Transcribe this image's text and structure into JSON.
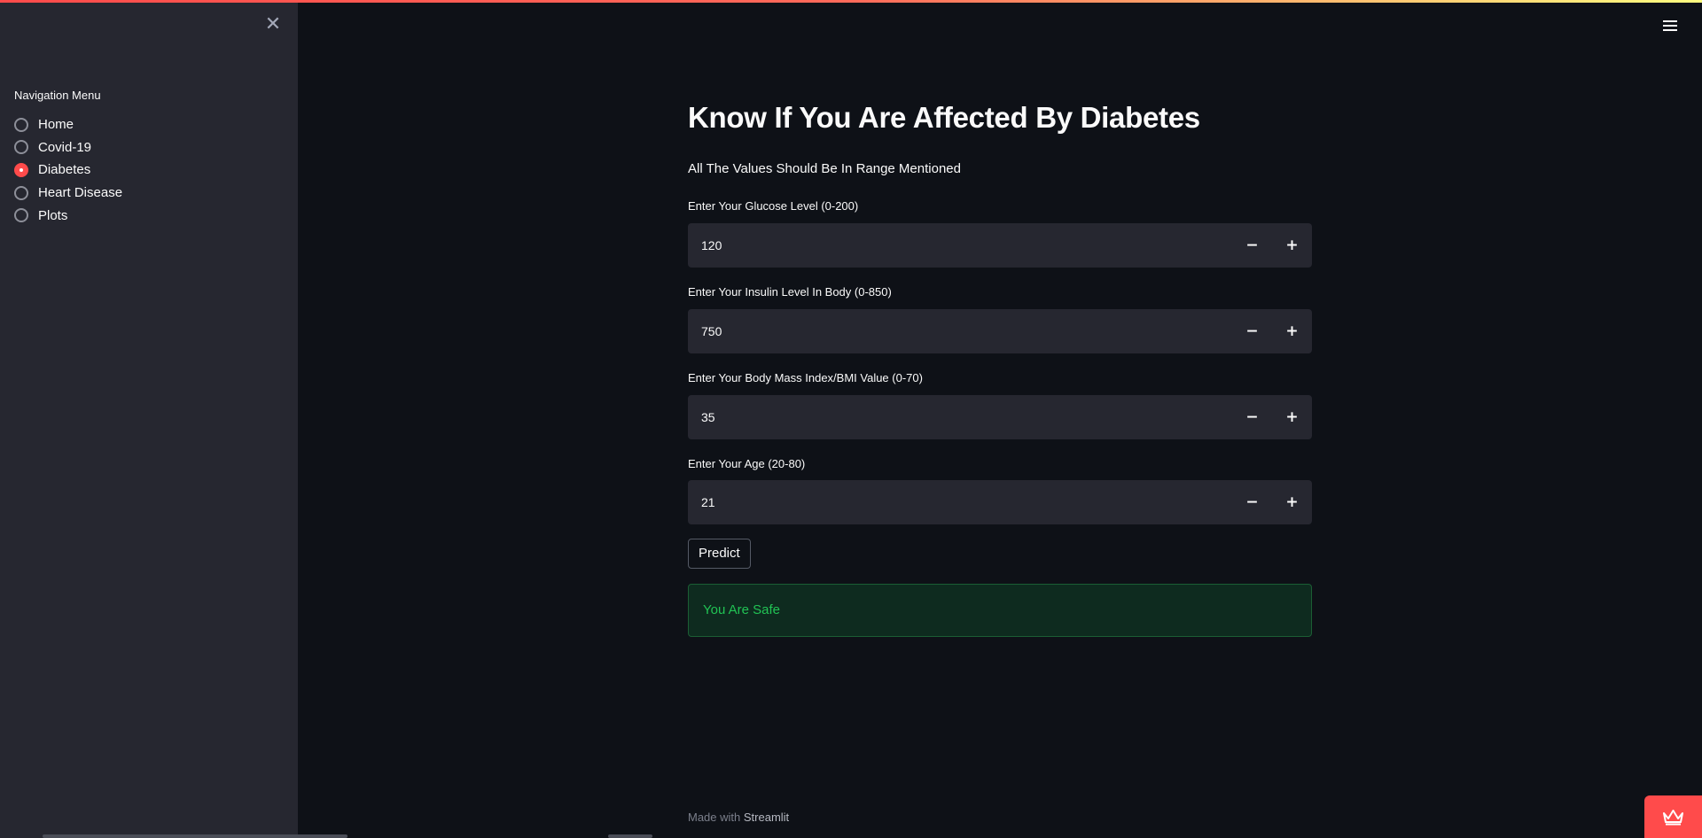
{
  "sidebar": {
    "close_icon": "✕",
    "nav_title": "Navigation Menu",
    "items": [
      {
        "label": "Home",
        "selected": false
      },
      {
        "label": "Covid-19",
        "selected": false
      },
      {
        "label": "Diabetes",
        "selected": true
      },
      {
        "label": "Heart Disease",
        "selected": false
      },
      {
        "label": "Plots",
        "selected": false
      }
    ]
  },
  "header": {
    "menu_icon": "hamburger-menu-icon"
  },
  "main": {
    "title": "Know If You Are Affected By Diabetes",
    "subtitle": "All The Values Should Be In Range Mentioned",
    "fields": [
      {
        "label": "Enter Your Glucose Level (0-200)",
        "value": "120"
      },
      {
        "label": "Enter Your Insulin Level In Body (0-850)",
        "value": "750"
      },
      {
        "label": "Enter Your Body Mass Index/BMI Value (0-70)",
        "value": "35"
      },
      {
        "label": "Enter Your Age (20-80)",
        "value": "21"
      }
    ],
    "stepper": {
      "minus": "−",
      "plus": "+"
    },
    "predict_label": "Predict",
    "result": "You Are Safe"
  },
  "footer": {
    "prefix": "Made with ",
    "brand": "Streamlit"
  },
  "colors": {
    "background": "#0e1117",
    "sidebar": "#262730",
    "accent": "#ff4b4b",
    "success_text": "#21c354",
    "success_bg": "#0e2b1f"
  }
}
